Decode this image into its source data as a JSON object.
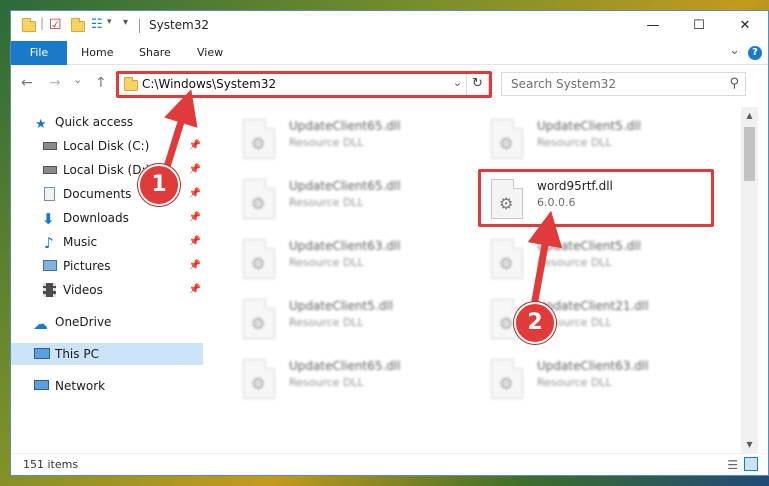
{
  "window": {
    "title": "System32",
    "controls": {
      "minimize": "—",
      "maximize": "☐",
      "close": "✕"
    }
  },
  "ribbon": {
    "tabs": [
      "File",
      "Home",
      "Share",
      "View"
    ],
    "collapse_glyph": "⌄",
    "help_glyph": "?"
  },
  "nav": {
    "back_glyph": "←",
    "forward_glyph": "→",
    "recent_glyph": "⌄",
    "up_glyph": "↑",
    "address": "C:\\Windows\\System32",
    "address_chevron": "⌄",
    "refresh_glyph": "↻",
    "search_placeholder": "Search System32",
    "search_glyph": "⚲"
  },
  "sidebar": {
    "items": [
      {
        "label": "Quick access",
        "icon": "star-icon",
        "pinned": false
      },
      {
        "label": "Local Disk (C:)",
        "icon": "drive-icon",
        "pinned": true
      },
      {
        "label": "Local Disk (D:)",
        "icon": "drive-icon",
        "pinned": true
      },
      {
        "label": "Documents",
        "icon": "documents-icon",
        "pinned": true
      },
      {
        "label": "Downloads",
        "icon": "downloads-icon",
        "pinned": true
      },
      {
        "label": "Music",
        "icon": "music-icon",
        "pinned": true
      },
      {
        "label": "Pictures",
        "icon": "pictures-icon",
        "pinned": true
      },
      {
        "label": "Videos",
        "icon": "videos-icon",
        "pinned": true
      },
      {
        "label": "OneDrive",
        "icon": "cloud-icon",
        "pinned": false
      },
      {
        "label": "This PC",
        "icon": "computer-icon",
        "pinned": false,
        "selected": true
      },
      {
        "label": "Network",
        "icon": "network-icon",
        "pinned": false
      }
    ],
    "pin_glyph": "📌"
  },
  "files": [
    {
      "name": "UpdateClient65.dll",
      "type": "Resource DLL",
      "blurred": true
    },
    {
      "name": "UpdateClient5.dll",
      "type": "Resource DLL",
      "blurred": true
    },
    {
      "name": "UpdateClient65.dll",
      "type": "Resource DLL",
      "blurred": true
    },
    {
      "name": "word95rtf.dll",
      "type": "6.0.0.6",
      "blurred": false
    },
    {
      "name": "UpdateClient63.dll",
      "type": "Resource DLL",
      "blurred": true
    },
    {
      "name": "UpdateClient5.dll",
      "type": "Resource DLL",
      "blurred": true
    },
    {
      "name": "UpdateClient5.dll",
      "type": "Resource DLL",
      "blurred": true
    },
    {
      "name": "UpdateClient21.dll",
      "type": "Resource DLL",
      "blurred": true
    },
    {
      "name": "UpdateClient65.dll",
      "type": "Resource DLL",
      "blurred": true
    },
    {
      "name": "UpdateClient63.dll",
      "type": "Resource DLL",
      "blurred": true
    }
  ],
  "status": {
    "item_count": "151 items"
  },
  "annotations": {
    "marker_1": "1",
    "marker_2": "2",
    "highlight_color": "#e03a3a"
  },
  "colors": {
    "accent": "#1979ca",
    "selection": "#cce4f7"
  }
}
